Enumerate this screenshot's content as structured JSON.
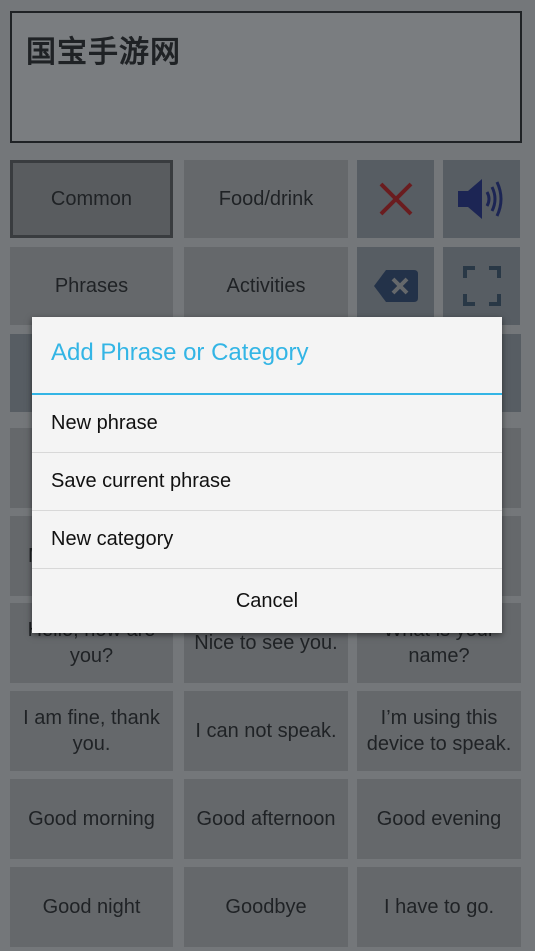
{
  "display": {
    "text": "国宝手游网"
  },
  "categories": [
    {
      "label": "Common",
      "selected": true
    },
    {
      "label": "Food/drink",
      "selected": false
    },
    {
      "label": "Phrases",
      "selected": false
    },
    {
      "label": "Activities",
      "selected": false
    }
  ],
  "controls": {
    "clear_icon": "close-x-icon",
    "speak_icon": "speaker-icon",
    "backspace_icon": "backspace-icon",
    "fullscreen_icon": "fullscreen-icon",
    "colors": {
      "clear": "#d40000",
      "speak": "#0a1a8c",
      "backspace": "#1c3a6e",
      "fullscreen": "#2a4a66"
    }
  },
  "phrases": {
    "partial_row_label": "M",
    "rows": [
      [
        "Hello, how are you?",
        "Nice to see you.",
        "What is your name?"
      ],
      [
        "I am fine, thank you.",
        "I can not speak.",
        "I’m using this device to speak."
      ],
      [
        "Good morning",
        "Good afternoon",
        "Good evening"
      ],
      [
        "Good night",
        "Goodbye",
        "I have to go."
      ]
    ]
  },
  "dialog": {
    "title": "Add Phrase or Category",
    "accent_color": "#33b5e5",
    "items": [
      "New phrase",
      "Save current phrase",
      "New category"
    ],
    "cancel_label": "Cancel"
  }
}
